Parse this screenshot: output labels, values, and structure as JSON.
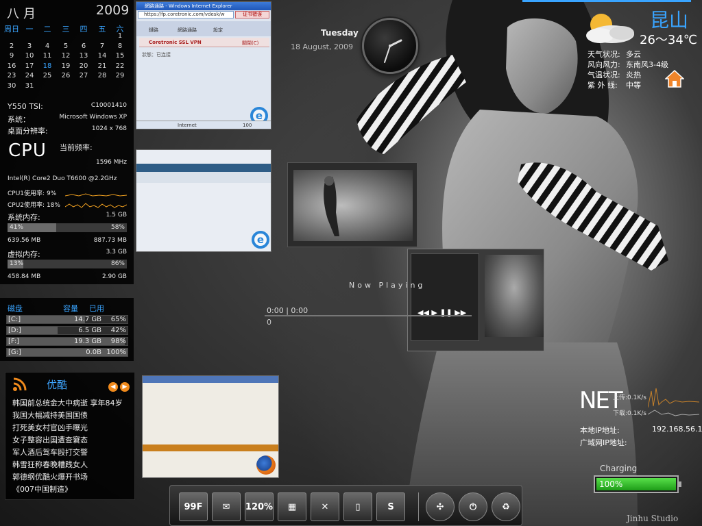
{
  "calendar": {
    "month": "八月",
    "year": "2009",
    "weekdays": [
      "周日",
      "一",
      "二",
      "三",
      "四",
      "五",
      "六"
    ],
    "days": [
      [
        "",
        "",
        "",
        "",
        "",
        "",
        "1"
      ],
      [
        "2",
        "3",
        "4",
        "5",
        "6",
        "7",
        "8"
      ],
      [
        "9",
        "10",
        "11",
        "12",
        "13",
        "14",
        "15"
      ],
      [
        "16",
        "17",
        "18",
        "19",
        "20",
        "21",
        "22"
      ],
      [
        "23",
        "24",
        "25",
        "26",
        "27",
        "28",
        "29"
      ],
      [
        "30",
        "31",
        "",
        "",
        "",
        "",
        ""
      ]
    ],
    "today": "18"
  },
  "system": {
    "model_label": "Y550 TSI:",
    "model_value": "C10001410",
    "os_label": "系统：",
    "os_value": "Microsoft Windows XP",
    "res_label": "桌面分辨率:",
    "res_value": "1024 x 768",
    "cpu_logo": "CPU",
    "freq_label": "当前频率:",
    "freq_value": "1596 MHz",
    "cpu_name": "Intel(R) Core2 Duo T6600 @2.2GHz",
    "cpu1_label": "CPU1使用率:",
    "cpu1_value": "9%",
    "cpu2_label": "CPU2使用率:",
    "cpu2_value": "18%",
    "mem_label": "系统内存:",
    "mem_total": "1.5 GB",
    "mem_bar_left": "41%",
    "mem_bar_right": "58%",
    "mem_used": "639.56 MB",
    "mem_free": "887.73 MB",
    "vmem_label": "虚拟内存:",
    "vmem_total": "3.3 GB",
    "vmem_bar_left": "13%",
    "vmem_bar_right": "86%",
    "vmem_used": "458.84 MB",
    "vmem_free": "2.90 GB",
    "mem_fill": 0.41,
    "vmem_fill": 0.13
  },
  "disks": {
    "headers": [
      "磁盘",
      "容量",
      "已用"
    ],
    "items": [
      {
        "name": "[C:]",
        "size": "14.7 GB",
        "used": "65%",
        "fill": 0.65
      },
      {
        "name": "[D:]",
        "size": "6.5 GB",
        "used": "42%",
        "fill": 0.42
      },
      {
        "name": "[F:]",
        "size": "19.3 GB",
        "used": "98%",
        "fill": 0.98
      },
      {
        "name": "[G:]",
        "size": "0.0B",
        "used": "100%",
        "fill": 1.0
      }
    ]
  },
  "news": {
    "title": "优酷",
    "items": [
      "韩国前总统金大中病逝 享年84岁",
      "我国大幅减持美国国债",
      "打死美女村官凶手曝光",
      "女子整容出国遭查窘态",
      "军人酒后驾车殴打交警",
      "韩雪狂称春晚糟践女人",
      "郭德纲优酷火爆开书场",
      "《007中国制造》"
    ]
  },
  "ie_window": {
    "title": "網路通路 - Windows Internet Explorer",
    "address": "https://fp.coretronic.com/vdesk/w",
    "cert": "证书错误",
    "tab1": "鏈路",
    "tab2": "網路通路",
    "tab3": "設定",
    "vpn": "Coretronic SSL VPN",
    "close": "關閉(C)",
    "status": "狀態：已连接",
    "zoom": "100",
    "statusbar": "Internet"
  },
  "clock": {
    "day": "Tuesday",
    "date": "18 August, 2009"
  },
  "media": {
    "now_playing": "Now Playing",
    "elapsed": "0:00",
    "total": "0:00",
    "position": "0"
  },
  "weather": {
    "city": "昆山",
    "temp": "26～34℃",
    "rows": [
      {
        "label": "天气状况:",
        "value": "多云"
      },
      {
        "label": "风向风力:",
        "value": "东南风3-4级"
      },
      {
        "label": "气温状况:",
        "value": "炎热"
      },
      {
        "label": "紫 外 线:",
        "value": "中等"
      }
    ]
  },
  "network": {
    "logo": "NET",
    "up": "上传:0.1K/s",
    "down": "下载:0.1K/s",
    "local_ip_label": "本地IP地址:",
    "local_ip": "192.168.56.1",
    "wan_ip_label": "广域网IP地址:",
    "wan_ip": ""
  },
  "battery": {
    "label": "Charging",
    "percent": "100%",
    "level": 1.0
  },
  "dock": {
    "items": [
      {
        "name": "weather-99f-icon",
        "label": "99F"
      },
      {
        "name": "mail-icon",
        "label": "✉"
      },
      {
        "name": "speed-icon",
        "label": "120%"
      },
      {
        "name": "photo-icon",
        "label": "▦"
      },
      {
        "name": "x-app-icon",
        "label": "✕"
      },
      {
        "name": "folder-icon",
        "label": "▯"
      },
      {
        "name": "skype-icon",
        "label": "S"
      },
      {
        "name": "fan-icon",
        "label": "✣"
      },
      {
        "name": "power-icon",
        "label": "⏻"
      },
      {
        "name": "recycle-bin-icon",
        "label": "♻"
      }
    ]
  },
  "watermark": "Jinhu Studio",
  "colors": {
    "accent": "#39a4ff",
    "battery": "#2ec42a",
    "rss": "#f08a1c"
  }
}
